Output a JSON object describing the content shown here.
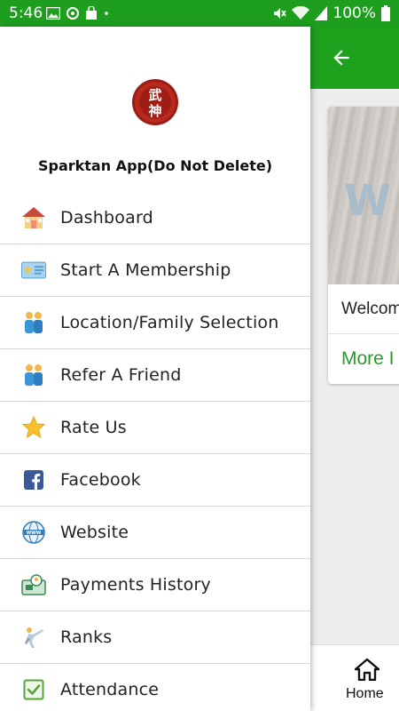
{
  "status_bar": {
    "time": "5:46",
    "battery": "100%",
    "left_icons": [
      "image-icon",
      "sync-icon",
      "shopping-bag-icon",
      "dot-icon"
    ],
    "right_icons": [
      "mute-icon",
      "wifi-icon",
      "signal-icon",
      "battery-icon"
    ]
  },
  "drawer": {
    "app_name": "Sparktan App(Do Not Delete)",
    "logo_text": "武神",
    "items": [
      {
        "label": "Dashboard",
        "icon": "house-icon"
      },
      {
        "label": "Start A Membership",
        "icon": "membership-card-icon"
      },
      {
        "label": "Location/Family Selection",
        "icon": "family-icon"
      },
      {
        "label": "Refer A Friend",
        "icon": "friends-icon"
      },
      {
        "label": "Rate Us",
        "icon": "star-icon"
      },
      {
        "label": "Facebook",
        "icon": "facebook-icon"
      },
      {
        "label": "Website",
        "icon": "globe-icon"
      },
      {
        "label": "Payments History",
        "icon": "payment-icon"
      },
      {
        "label": "Ranks",
        "icon": "martial-arts-icon"
      },
      {
        "label": "Attendance",
        "icon": "checkbox-icon"
      }
    ]
  },
  "background": {
    "card_image_text": "W",
    "card_welcome": "Welcom",
    "card_more": "More I",
    "bottom_nav": {
      "home_label": "Home"
    }
  },
  "colors": {
    "primary": "#1ea21e",
    "link": "#2a9b2a"
  }
}
